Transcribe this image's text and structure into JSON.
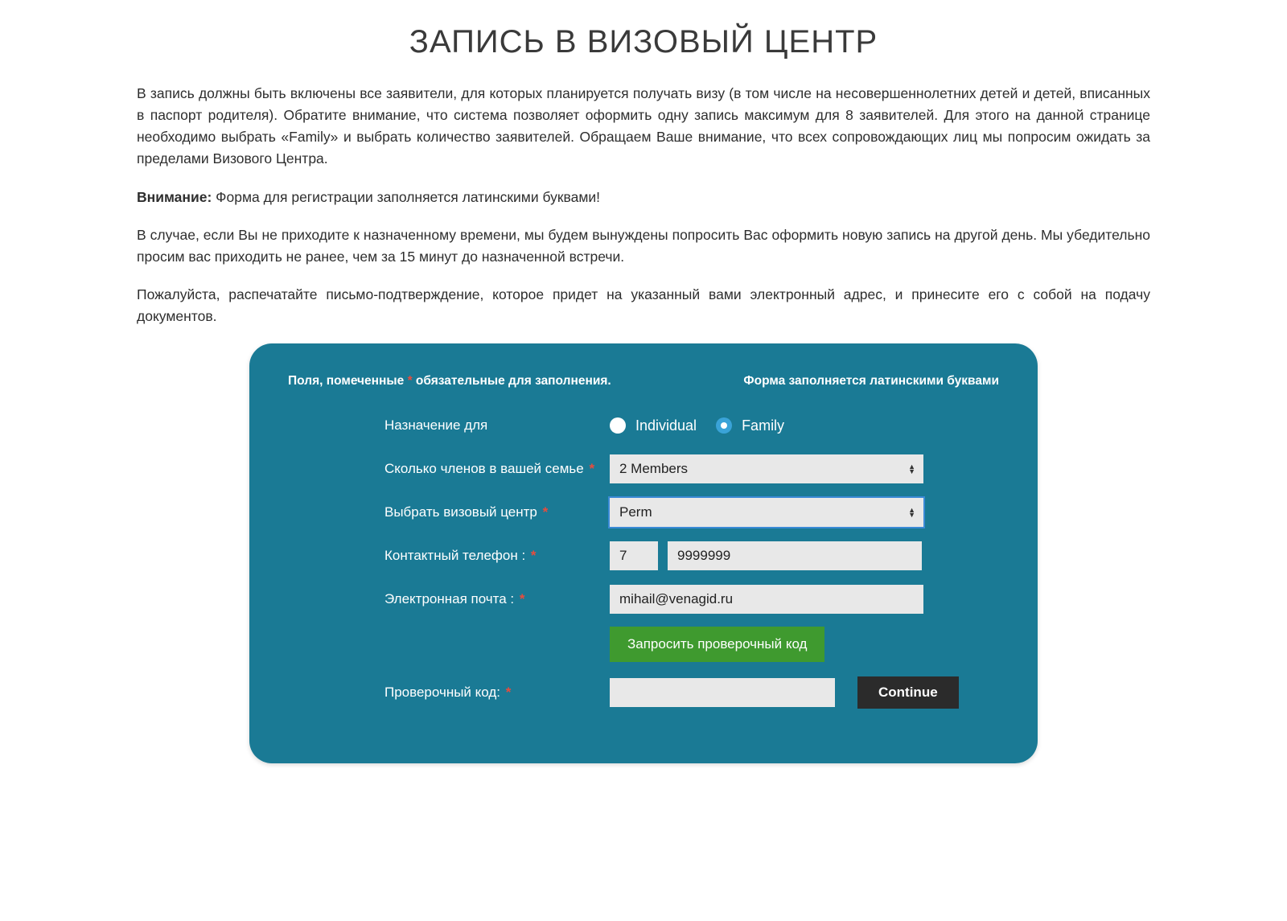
{
  "title": "ЗАПИСЬ В ВИЗОВЫЙ ЦЕНТР",
  "para1": "В запись должны быть включены все заявители, для которых планируется получать визу (в том числе на несовершеннолетних детей и детей, вписанных в паспорт родителя). Обратите внимание, что система позволяет оформить одну запись максимум для 8 заявителей. Для этого на данной странице необходимо выбрать «Family» и выбрать количество заявителей. Обращаем Ваше внимание, что всех сопровождающих лиц мы попросим ожидать за пределами Визового Центра.",
  "para2_bold": "Внимание:",
  "para2_rest": " Форма для регистрации заполняется латинскими буквами!",
  "para3": "В случае, если Вы не приходите к назначенному времени, мы будем вынуждены попросить Вас оформить новую запись на другой день. Мы убедительно просим вас приходить не ранее, чем за 15 минут до назначенной встречи.",
  "para4": "Пожалуйста, распечатайте письмо-подтверждение, которое придет на указанный вами электронный адрес, и принесите его с собой на подачу документов.",
  "form": {
    "note_left_pre": "Поля, помеченные ",
    "note_left_ast": "*",
    "note_left_post": " обязательные для заполнения.",
    "note_right": "Форма заполняется латинскими буквами",
    "labels": {
      "assignment": "Назначение для",
      "members": "Сколько членов в вашей семье",
      "center": "Выбрать визовый центр",
      "phone": "Контактный телефон :",
      "email": "Электронная почта :",
      "code": "Проверочный код:"
    },
    "radio": {
      "individual": "Individual",
      "family": "Family",
      "selected": "family"
    },
    "members_value": "2 Members",
    "center_value": "Perm",
    "phone_cc": "7",
    "phone_num": "9999999",
    "email_value": "mihail@venagid.ru",
    "request_code_btn": "Запросить проверочный код",
    "continue_btn": "Continue",
    "code_value": ""
  }
}
